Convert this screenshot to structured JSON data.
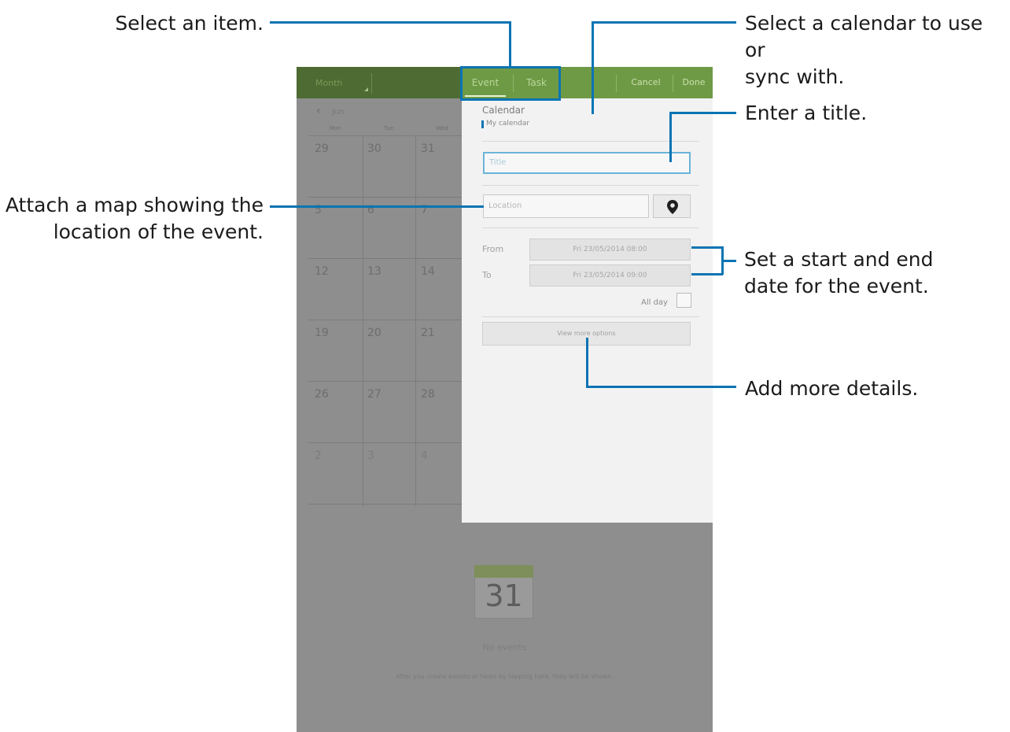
{
  "callouts": {
    "select_item": "Select an item.",
    "select_calendar_line1": "Select a calendar to use or",
    "select_calendar_line2": "sync with.",
    "enter_title": "Enter a title.",
    "attach_map_line1": "Attach a map showing the",
    "attach_map_line2": "location of the event.",
    "set_date_line1": "Set a start and end",
    "set_date_line2": "date for the event.",
    "add_details": "Add more details."
  },
  "action_bar": {
    "view_spinner": "Month",
    "tabs": [
      "Event",
      "Task"
    ],
    "cancel": "Cancel",
    "done": "Done"
  },
  "calendar": {
    "month_label": "Jun",
    "weekdays": [
      "Mon",
      "Tue",
      "Wed"
    ],
    "weeks": [
      [
        "29",
        "30",
        "31"
      ],
      [
        "5",
        "6",
        "7"
      ],
      [
        "12",
        "13",
        "14"
      ],
      [
        "19",
        "20",
        "21"
      ],
      [
        "26",
        "27",
        "28"
      ],
      [
        "2",
        "3",
        "4"
      ]
    ]
  },
  "event_form": {
    "calendar_label": "Calendar",
    "calendar_value": "My calendar",
    "title_placeholder": "Title",
    "location_placeholder": "Location",
    "from_label": "From",
    "from_value": "Fri 23/05/2014 08:00",
    "to_label": "To",
    "to_value": "Fri 23/05/2014 09:00",
    "all_day_label": "All day",
    "more_options": "View more options"
  },
  "empty_state": {
    "icon_number": "31",
    "no_events": "No events",
    "hint": "After you create events or tasks by tapping here, they will be shown."
  },
  "colors": {
    "leader": "#0a74b3",
    "action_bar_dark": "#4e6b33",
    "action_bar_light": "#6f9a45"
  }
}
